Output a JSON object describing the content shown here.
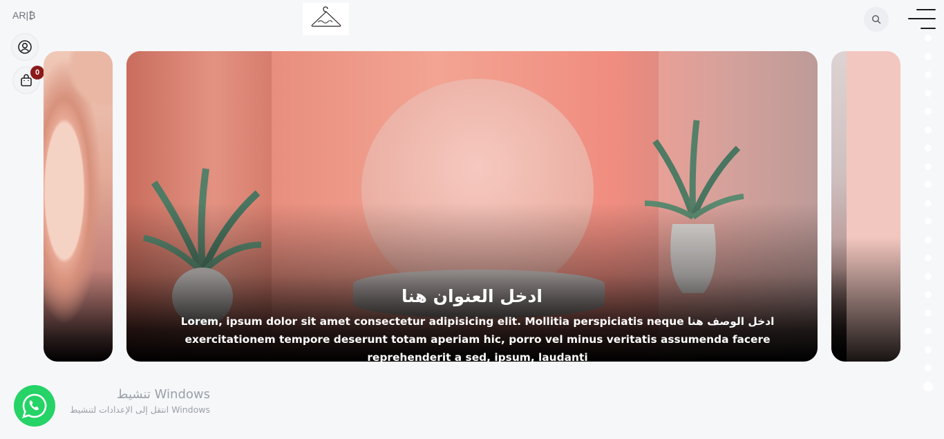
{
  "header": {
    "language_label": "AR|₿"
  },
  "cart": {
    "count": "0"
  },
  "slider": {
    "title": "ادخل العنوان هنا",
    "description": "ادخل الوصف هنا Lorem, ipsum dolor sit amet consectetur adipisicing elit. Mollitia perspiciatis neque exercitationem tempore deserunt totam aperiam hic, porro vel minus veritatis assumenda facere reprehenderit a sed, ipsum, laudanti",
    "dot_count": 20,
    "active_dot": 19
  },
  "watermark": {
    "title": "تنشيط Windows",
    "subtitle": "انتقل إلى الإعدادات لتنشيط Windows"
  },
  "icons": {
    "logo": "hanger-logo",
    "search": "search-icon",
    "menu": "hamburger-menu-icon",
    "user": "user-circle-icon",
    "cart": "shopping-bag-icon",
    "whatsapp": "whatsapp-icon"
  },
  "colors": {
    "badge": "#8b1a1a",
    "whatsapp": "#25d366",
    "background": "#f6f7f9"
  }
}
